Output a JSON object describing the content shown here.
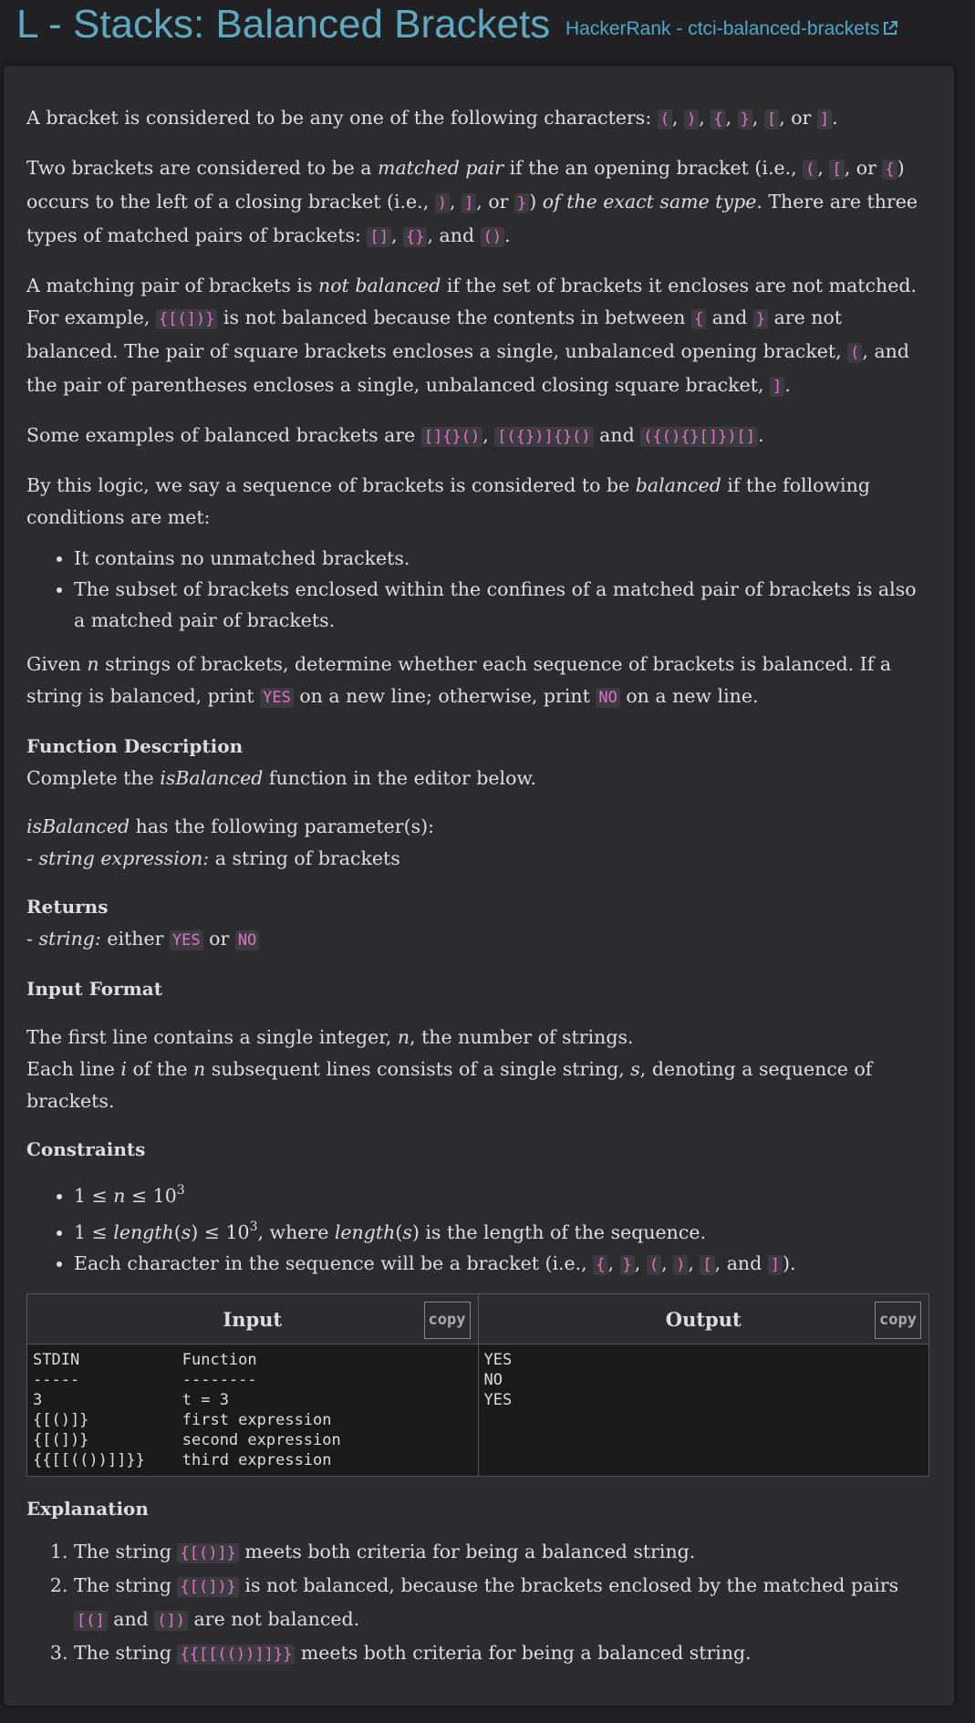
{
  "header": {
    "title": "L - Stacks: Balanced Brackets",
    "source_link": "HackerRank - ctci-balanced-brackets"
  },
  "p1": {
    "t1": "A bracket is considered to be any one of the following characters: ",
    "c1": "(",
    "c2": ")",
    "c3": "{",
    "c4": "}",
    "c5": "[",
    "c6": "]",
    "sep": ", ",
    "or": ", or ",
    "end": "."
  },
  "p2": {
    "t1": "Two brackets are considered to be a ",
    "em1": "matched pair",
    "t2": " if the an opening bracket (i.e., ",
    "c1": "(",
    "c2": "[",
    "c3": "{",
    "t3": ") occurs to the left of a closing bracket (i.e., ",
    "c4": ")",
    "c5": "]",
    "c6": "}",
    "t4": ") ",
    "em2": "of the exact same type",
    "t5": ". There are three types of matched pairs of brackets: ",
    "c7": "[]",
    "c8": "{}",
    "c9": "()",
    "and": ", and ",
    "end": "."
  },
  "p3": {
    "t1": "A matching pair of brackets is ",
    "em1": "not balanced",
    "t2": " if the set of brackets it encloses are not matched. For example, ",
    "c1": "{[(])}",
    "t3": " is not balanced because the contents in between ",
    "c2": "{",
    "and": " and ",
    "c3": "}",
    "t4": " are not balanced. The pair of square brackets encloses a single, unbalanced opening bracket, ",
    "c4": "(",
    "t5": ", and the pair of parentheses encloses a single, unbalanced closing square bracket, ",
    "c5": "]",
    "end": "."
  },
  "p4": {
    "t1": "Some examples of balanced brackets are ",
    "c1": "[]{}()",
    "c2": "[({})]{}()",
    "c3": "({(){}[]})[]",
    "sep": ", ",
    "and": " and ",
    "end": "."
  },
  "p5": {
    "t1": "By this logic, we say a sequence of brackets is considered to be ",
    "em1": "balanced",
    "t2": " if the following conditions are met:"
  },
  "conditions": [
    "It contains no unmatched brackets.",
    "The subset of brackets enclosed within the confines of a matched pair of brackets is also a matched pair of brackets."
  ],
  "p6": {
    "t1": "Given ",
    "m1": "n",
    "t2": " strings of brackets, determine whether each sequence of brackets is balanced. If a string is balanced, print ",
    "c1": "YES",
    "t3": " on a new line; otherwise, print ",
    "c2": "NO",
    "t4": " on a new line."
  },
  "function_description": {
    "heading": "Function Description",
    "t1": "Complete the ",
    "em1": "isBalanced",
    "t2": " function in the editor below."
  },
  "params": {
    "em1": "isBalanced",
    "t1": " has the following parameter(s):",
    "dash": "- ",
    "em2": "string expression:",
    "t2": " a string of brackets"
  },
  "returns": {
    "heading": "Returns",
    "dash": "- ",
    "em1": "string:",
    "t1": " either ",
    "c1": "YES",
    "or": " or ",
    "c2": "NO"
  },
  "input_format": {
    "heading": "Input Format",
    "l1a": "The first line contains a single integer, ",
    "m1": "n",
    "l1b": ", the number of strings.",
    "l2a": "Each line ",
    "m2": "i",
    "l2b": " of the ",
    "m3": "n",
    "l2c": " subsequent lines consists of a single string, ",
    "m4": "s",
    "l2d": ", denoting a sequence of brackets."
  },
  "constraints": {
    "heading": "Constraints",
    "c1a": "1 ≤ ",
    "c1m": "n",
    "c1b": " ≤ 10",
    "c1sup": "3",
    "c2a": "1 ≤ ",
    "c2m": "length",
    "c2b": "(",
    "c2m2": "s",
    "c2c": ") ≤ 10",
    "c2sup": "3",
    "c2d": ", where ",
    "c2m3": "length",
    "c2e": "(",
    "c2m4": "s",
    "c2f": ")",
    "c2g": " is the length of the sequence.",
    "c3a": "Each character in the sequence will be a bracket (i.e., ",
    "k1": "{",
    "k2": "}",
    "k3": "(",
    "k4": ")",
    "k5": "[",
    "k6": "]",
    "sep": ", ",
    "and": ", and ",
    "c3end": ")."
  },
  "sample": {
    "input_header": "Input",
    "output_header": "Output",
    "copy_label": "copy",
    "input_text": "STDIN           Function\n-----           --------\n3               t = 3\n{[()]}          first expression\n{[(])}          second expression\n{{[[(())]]}}    third expression",
    "output_text": "YES\nNO\nYES"
  },
  "explanation": {
    "heading": "Explanation",
    "i1a": "The string ",
    "i1c": "{[()]}",
    "i1b": " meets both criteria for being a balanced string.",
    "i2a": "The string ",
    "i2c": "{[(])}",
    "i2b": " is not balanced, because the brackets enclosed by the matched pairs ",
    "i2c2": "[(]",
    "i2and": " and ",
    "i2c3": "(])",
    "i2d": " are not balanced.",
    "i3a": "The string ",
    "i3c": "{{[[(())]]}}",
    "i3b": " meets both criteria for being a balanced string."
  },
  "colors": {
    "title": "#5fa8c4",
    "link": "#4ba8c8",
    "code": "#e070c8",
    "background": "#212124",
    "card": "#2c2c2f"
  },
  "icons": {
    "external_link": "external-link-icon"
  }
}
